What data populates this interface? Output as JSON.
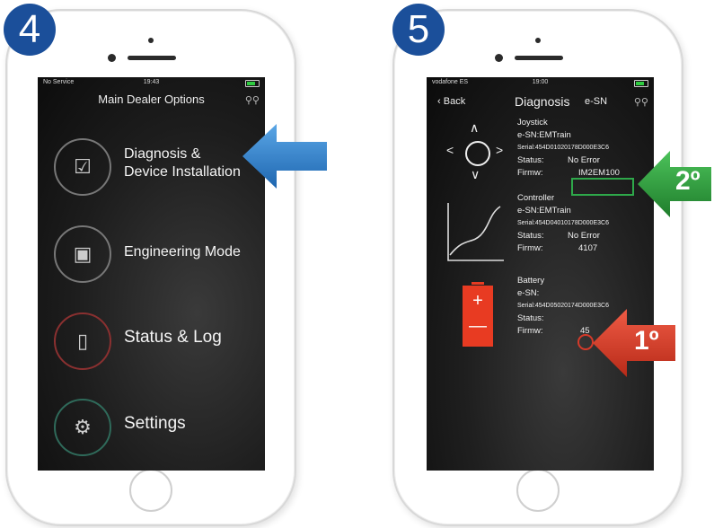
{
  "steps": {
    "left": "4",
    "right": "5"
  },
  "screen4": {
    "status": {
      "carrier": "No Service",
      "time": "19:43"
    },
    "title": "Main Dealer Options",
    "menu": [
      {
        "label_line1": "Diagnosis &",
        "label_line2": "Device Installation",
        "icon": "checklist-icon"
      },
      {
        "label_line1": "Engineering Mode",
        "icon": "chip-icon"
      },
      {
        "label_line1": "Status & Log",
        "icon": "battery-icon"
      },
      {
        "label_line1": "Settings",
        "icon": "gear-icon"
      }
    ]
  },
  "screen5": {
    "status": {
      "carrier": "vodafone ES",
      "time": "19:00"
    },
    "back": "Back",
    "title": "Diagnosis",
    "esn": "e-SN",
    "joystick": {
      "heading": "Joystick",
      "esn": "e-SN:EMTrain",
      "serial": "Serial:454D01020178D000E3C6",
      "status_label": "Status:",
      "status_value": "No Error",
      "firmw_label": "Firmw:",
      "firmw_value": "IM2EM100"
    },
    "controller": {
      "heading": "Controller",
      "esn": "e-SN:EMTrain",
      "serial": "Serial:454D04010178D000E3C6",
      "status_label": "Status:",
      "status_value": "No Error",
      "firmw_label": "Firmw:",
      "firmw_value": "4107"
    },
    "battery": {
      "heading": "Battery",
      "esn": "e-SN:",
      "serial": "Serial:454D05020174D000E3C6",
      "status_label": "Status:",
      "firmw_label": "Firmw:",
      "firmw_value": "45"
    }
  },
  "callouts": {
    "green": {
      "label": "2º",
      "color": "#2e9d3a"
    },
    "red": {
      "label": "1º",
      "color": "#d83a25"
    },
    "blue_color": "#2f7fc6"
  },
  "colors": {
    "badge": "#1b4f9a",
    "battery_red": "#e83b22"
  }
}
